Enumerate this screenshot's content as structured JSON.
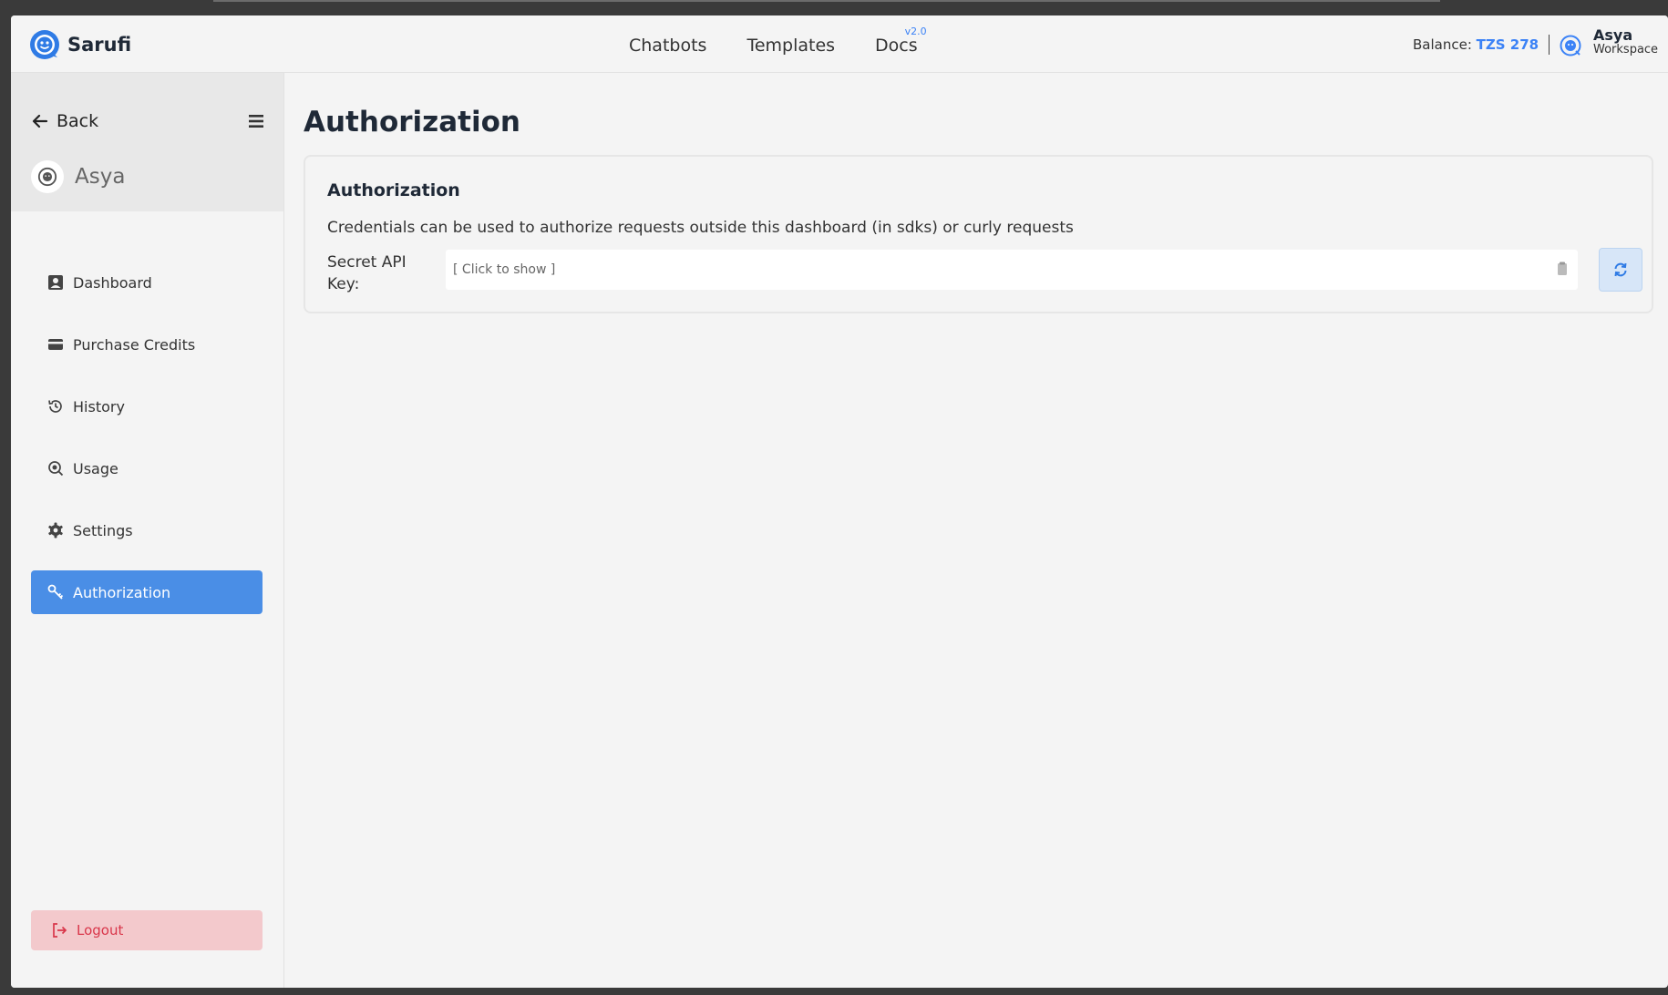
{
  "app": {
    "brand": "Sarufi",
    "accent_color": "#3b82f6"
  },
  "header": {
    "nav": [
      {
        "label": "Chatbots"
      },
      {
        "label": "Templates"
      },
      {
        "label": "Docs",
        "badge": "v2.0"
      }
    ],
    "balance_label": "Balance:",
    "balance_amount": "TZS 278",
    "user_name": "Asya",
    "workspace_label": "Workspace"
  },
  "sidebar": {
    "back_label": "Back",
    "user_name": "Asya",
    "items": [
      {
        "label": "Dashboard",
        "icon": "dashboard-icon"
      },
      {
        "label": "Purchase Credits",
        "icon": "credit-card-icon"
      },
      {
        "label": "History",
        "icon": "history-icon"
      },
      {
        "label": "Usage",
        "icon": "usage-icon"
      },
      {
        "label": "Settings",
        "icon": "gear-icon"
      },
      {
        "label": "Authorization",
        "icon": "key-icon",
        "active": true
      }
    ],
    "logout_label": "Logout"
  },
  "main": {
    "page_title": "Authorization",
    "card": {
      "title": "Authorization",
      "description": "Credentials can be used to authorize requests outside this dashboard (in sdks) or curly requests",
      "key_label": "Secret API Key:",
      "key_value": "[ Click to show ]"
    }
  }
}
